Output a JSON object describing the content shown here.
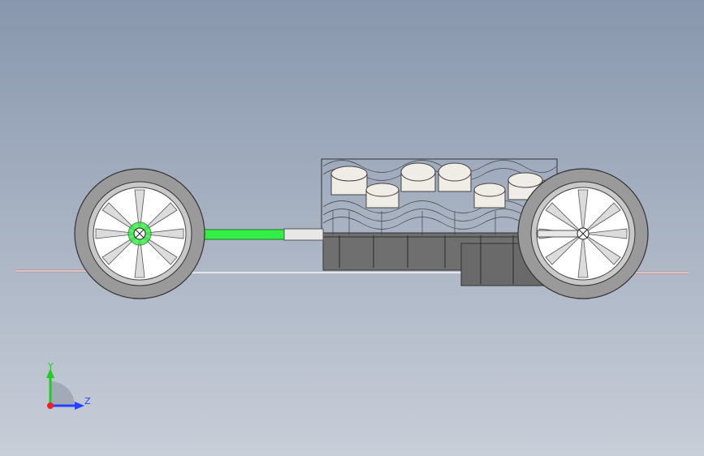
{
  "viewport": {
    "background_top": "#8897ad",
    "background_bottom": "#c8ced8"
  },
  "model": {
    "wheel_tire_color": "#9a9a9a",
    "wheel_rim_color": "#ffffff",
    "shaft_color": "#33ee44",
    "engine_block_color": "#6f6f6f",
    "piston_color": "#f0ede6",
    "ground_line_color": "#b88a8a",
    "icons": [
      "front-wheel-icon",
      "rear-wheel-icon",
      "drive-shaft-icon",
      "engine-block-icon",
      "piston-icon"
    ]
  },
  "triad": {
    "y_label": "Y",
    "z_label": "Z",
    "y_color": "#22cc22",
    "z_color": "#2244ff",
    "x_color": "#ee2222"
  }
}
